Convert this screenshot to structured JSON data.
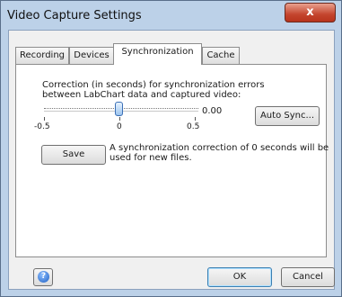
{
  "window": {
    "title": "Video Capture Settings",
    "close_glyph": "x"
  },
  "tabs": [
    {
      "label": "Recording"
    },
    {
      "label": "Devices"
    },
    {
      "label": "Synchronization"
    },
    {
      "label": "Cache"
    }
  ],
  "active_tab": "Synchronization",
  "sync": {
    "description": "Correction (in seconds) for synchronization errors between LabChart data and captured video:",
    "slider_min_label": "-0.5",
    "slider_mid_label": "0",
    "slider_max_label": "0.5",
    "slider_value": 0.0,
    "value_text": "0.00",
    "auto_sync_label": "Auto Sync...",
    "save_label": "Save",
    "note": "A synchronization correction of 0 seconds will be used for new files."
  },
  "footer": {
    "ok_label": "OK",
    "cancel_label": "Cancel",
    "help_icon": "help-icon"
  },
  "colors": {
    "accent": "#3b6fb6",
    "close": "#c4452e"
  }
}
